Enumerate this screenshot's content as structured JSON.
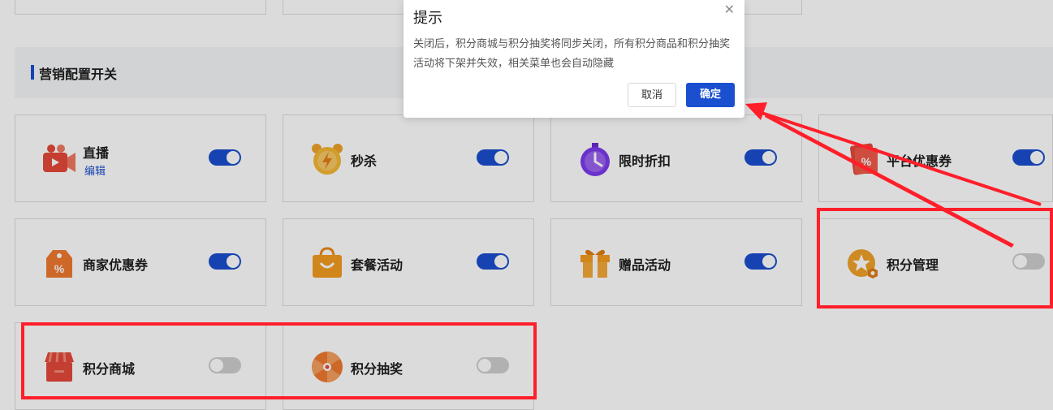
{
  "section": {
    "title": "营销配置开关"
  },
  "cards": [
    {
      "id": "live",
      "label": "直播",
      "sub": "编辑",
      "icon": "video-camera-icon",
      "enabled": true
    },
    {
      "id": "seckill",
      "label": "秒杀",
      "icon": "alarm-clock-icon",
      "enabled": true
    },
    {
      "id": "timed-discount",
      "label": "限时折扣",
      "icon": "stopwatch-icon",
      "enabled": true
    },
    {
      "id": "platform-coupon",
      "label": "平台优惠券",
      "icon": "coupon-icon",
      "enabled": true
    },
    {
      "id": "merchant-coupon",
      "label": "商家优惠券",
      "icon": "price-tag-icon",
      "enabled": true
    },
    {
      "id": "package",
      "label": "套餐活动",
      "icon": "shopping-bag-icon",
      "enabled": true
    },
    {
      "id": "gift",
      "label": "赠品活动",
      "icon": "gift-icon",
      "enabled": true
    },
    {
      "id": "points-manage",
      "label": "积分管理",
      "icon": "star-coin-icon",
      "enabled": false
    },
    {
      "id": "points-mall",
      "label": "积分商城",
      "icon": "store-icon",
      "enabled": false
    },
    {
      "id": "points-lottery",
      "label": "积分抽奖",
      "icon": "lottery-wheel-icon",
      "enabled": false
    }
  ],
  "dialog": {
    "title": "提示",
    "message": "关闭后，积分商城与积分抽奖将同步关闭，所有积分商品和积分抽奖活动将下架并失效，相关菜单也会自动隐藏",
    "cancel_label": "取消",
    "ok_label": "确定",
    "close_icon": "close-icon"
  },
  "colors": {
    "primary": "#1a4fcf",
    "highlight": "#ff1f2a",
    "toggle_off": "#cfcfcf"
  }
}
